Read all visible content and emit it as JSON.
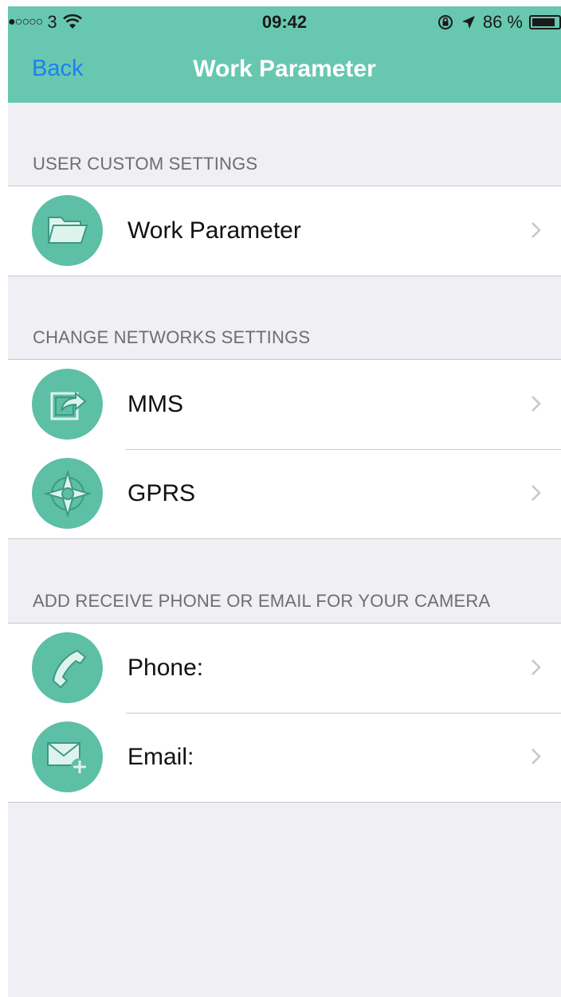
{
  "status_bar": {
    "signal": "●○○○○",
    "carrier": "3",
    "time": "09:42",
    "battery": "86 %",
    "battery_level": 0.86
  },
  "nav": {
    "back_label": "Back",
    "title": "Work Parameter"
  },
  "sections": [
    {
      "header": "USER CUSTOM SETTINGS",
      "items": [
        {
          "label": "Work Parameter",
          "icon": "folder-icon"
        }
      ]
    },
    {
      "header": "CHANGE NETWORKS SETTINGS",
      "items": [
        {
          "label": "MMS",
          "icon": "share-icon"
        },
        {
          "label": "GPRS",
          "icon": "compass-icon"
        }
      ]
    },
    {
      "header": "ADD RECEIVE PHONE OR EMAIL FOR YOUR CAMERA",
      "items": [
        {
          "label": "Phone:",
          "icon": "phone-icon"
        },
        {
          "label": "Email:",
          "icon": "email-add-icon"
        }
      ]
    }
  ],
  "colors": {
    "accent": "#68c7b0",
    "icon_bg": "#5cbfa6",
    "link": "#1e7ef0",
    "background": "#efeff4"
  }
}
